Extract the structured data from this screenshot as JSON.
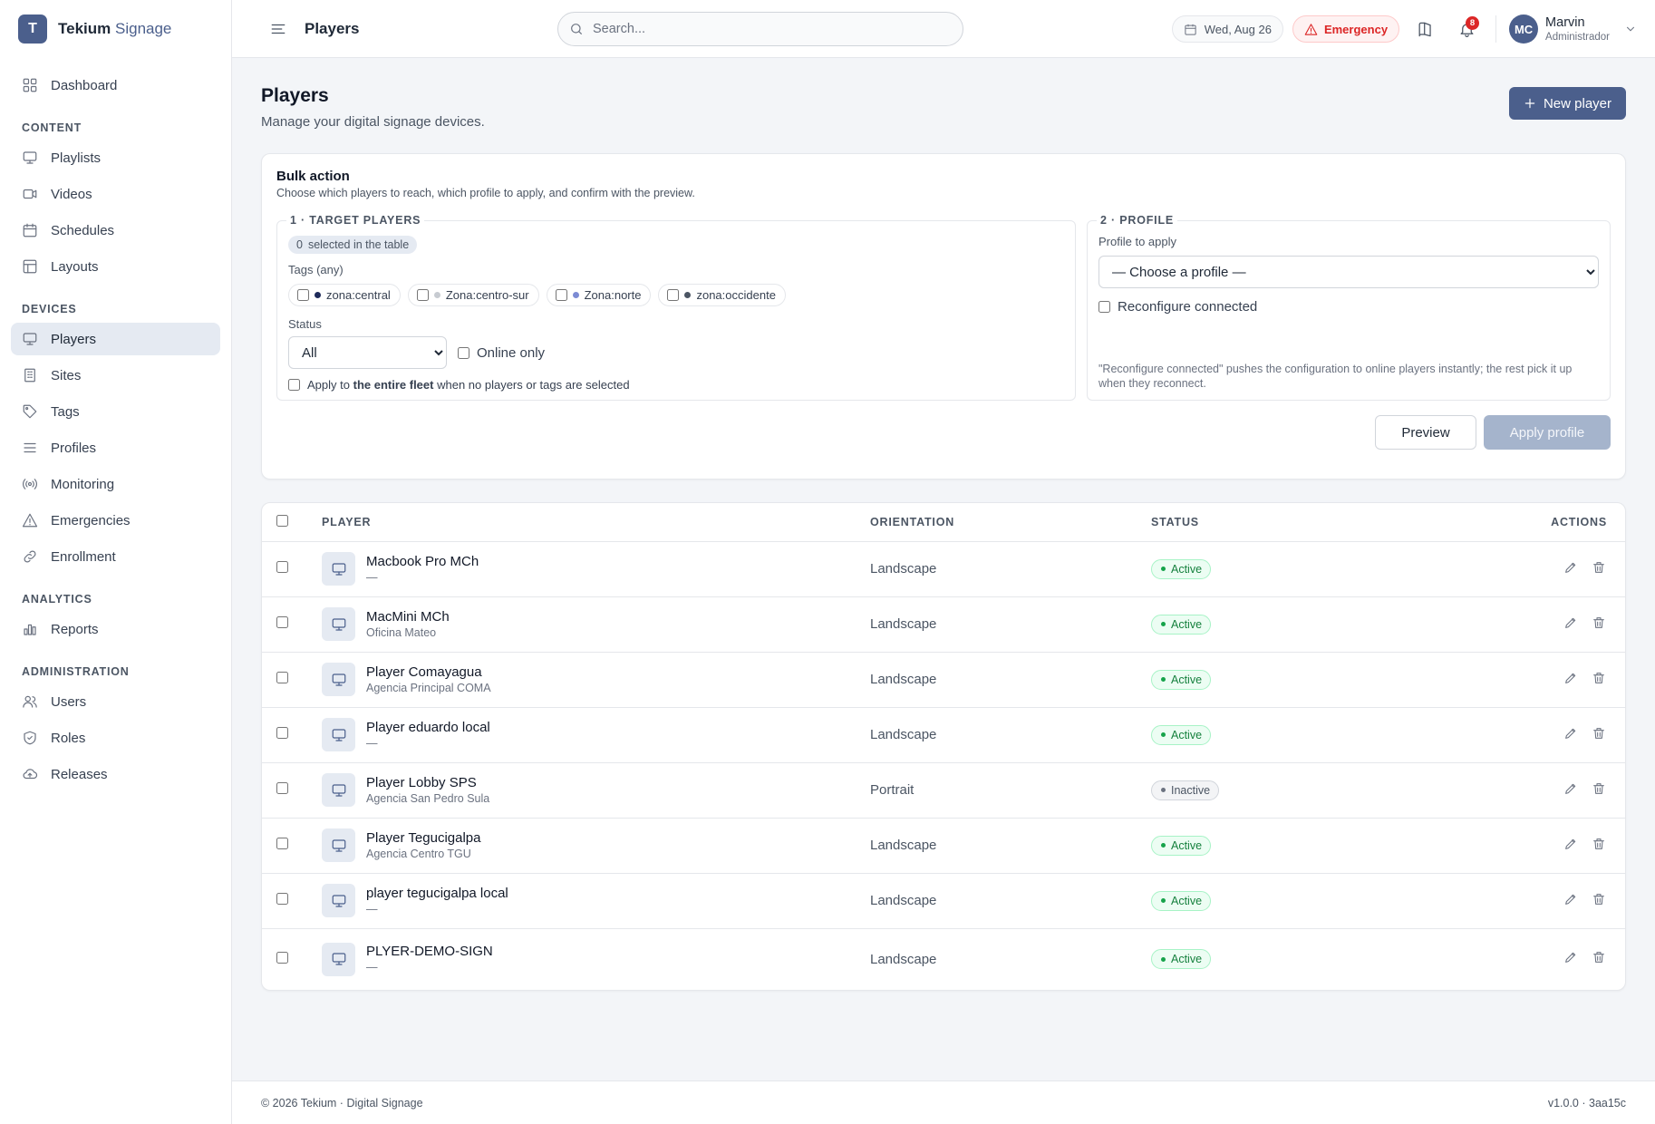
{
  "brand": {
    "logo_letter": "T",
    "name": "Tekium",
    "name_accent": "Signage"
  },
  "sidebar": {
    "dashboard": "Dashboard",
    "sections": {
      "content": "CONTENT",
      "devices": "DEVICES",
      "analytics": "ANALYTICS",
      "administration": "ADMINISTRATION"
    },
    "items": {
      "playlists": "Playlists",
      "videos": "Videos",
      "schedules": "Schedules",
      "layouts": "Layouts",
      "players": "Players",
      "sites": "Sites",
      "tags": "Tags",
      "profiles": "Profiles",
      "monitoring": "Monitoring",
      "emergencies": "Emergencies",
      "enrollment": "Enrollment",
      "reports": "Reports",
      "users": "Users",
      "roles": "Roles",
      "releases": "Releases"
    },
    "active": "players"
  },
  "header": {
    "title": "Players",
    "search_placeholder": "Search...",
    "date": "Wed, Aug 26",
    "emergency": "Emergency",
    "notifications_count": "8",
    "user": {
      "initials": "MC",
      "name": "Marvin",
      "role": "Administrador"
    }
  },
  "page": {
    "title": "Players",
    "subtitle": "Manage your digital signage devices.",
    "new_button": "New player"
  },
  "bulk": {
    "title": "Bulk action",
    "subtitle": "Choose which players to reach, which profile to apply, and confirm with the preview.",
    "target": {
      "legend": "1 · TARGET PLAYERS",
      "selected_count": "0",
      "selected_text": "selected in the table",
      "tags_label": "Tags (any)",
      "tags": [
        {
          "label": "zona:central",
          "color": "#1e2a5a"
        },
        {
          "label": "Zona:centro-sur",
          "color": "#c7cbd1"
        },
        {
          "label": "Zona:norte",
          "color": "#7c8bd4"
        },
        {
          "label": "zona:occidente",
          "color": "#4b5563"
        }
      ],
      "status_label": "Status",
      "status_value": "All",
      "online_only": "Online only",
      "fleet_prefix": "Apply to",
      "fleet_bold": "the entire fleet",
      "fleet_suffix": "when no players or tags are selected"
    },
    "profile": {
      "legend": "2 · PROFILE",
      "label": "Profile to apply",
      "placeholder": "— Choose a profile —",
      "reconfigure": "Reconfigure connected",
      "hint": "\"Reconfigure connected\" pushes the configuration to online players instantly; the rest pick it up when they reconnect."
    },
    "preview_button": "Preview",
    "apply_button": "Apply profile"
  },
  "table": {
    "headers": {
      "player": "PLAYER",
      "orientation": "ORIENTATION",
      "status": "STATUS",
      "actions": "ACTIONS"
    },
    "rows": [
      {
        "name": "Macbook Pro MCh",
        "site": "—",
        "orientation": "Landscape",
        "status": "Active"
      },
      {
        "name": "MacMini MCh",
        "site": "Oficina Mateo",
        "orientation": "Landscape",
        "status": "Active"
      },
      {
        "name": "Player Comayagua",
        "site": "Agencia Principal COMA",
        "orientation": "Landscape",
        "status": "Active"
      },
      {
        "name": "Player eduardo local",
        "site": "—",
        "orientation": "Landscape",
        "status": "Active"
      },
      {
        "name": "Player Lobby SPS",
        "site": "Agencia San Pedro Sula",
        "orientation": "Portrait",
        "status": "Inactive"
      },
      {
        "name": "Player Tegucigalpa",
        "site": "Agencia Centro TGU",
        "orientation": "Landscape",
        "status": "Active"
      },
      {
        "name": "player tegucigalpa local",
        "site": "—",
        "orientation": "Landscape",
        "status": "Active"
      },
      {
        "name": "PLYER-DEMO-SIGN",
        "site": "—",
        "orientation": "Landscape",
        "status": "Active"
      }
    ]
  },
  "footer": {
    "left": "© 2026 Tekium · Digital Signage",
    "right": "v1.0.0 · 3aa15c"
  },
  "colors": {
    "accent": "#4b5f8c",
    "danger": "#dc2626",
    "success": "#15803d"
  }
}
